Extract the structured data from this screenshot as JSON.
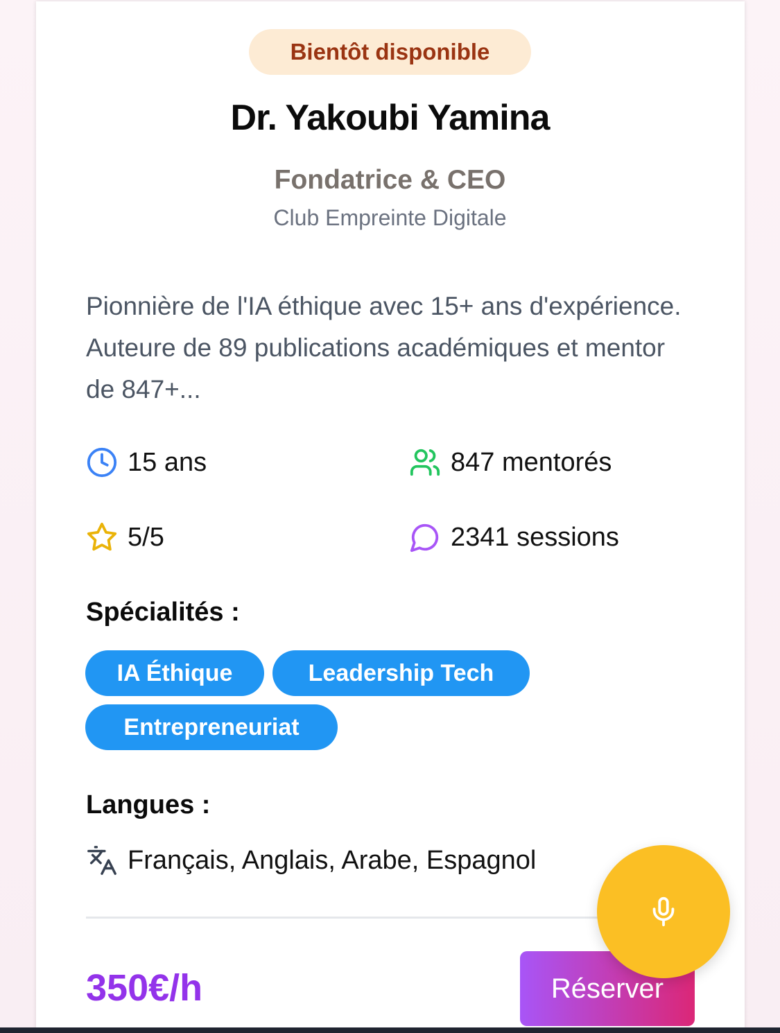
{
  "badge": "Bientôt disponible",
  "mentor": {
    "name": "Dr. Yakoubi Yamina",
    "role": "Fondatrice & CEO",
    "organization": "Club Empreinte Digitale",
    "bio": "Pionnière de l'IA éthique avec 15+ ans d'expérience. Auteure de 89 publications académiques et mentor de 847+..."
  },
  "stats": {
    "experience": "15 ans",
    "mentees": "847 mentorés",
    "rating": "5/5",
    "sessions": "2341 sessions"
  },
  "specialties": {
    "title": "Spécialités :",
    "items": [
      "IA Éthique",
      "Leadership Tech",
      "Entrepreneuriat"
    ]
  },
  "languages": {
    "title": "Langues :",
    "value": "Français, Anglais, Arabe, Espagnol"
  },
  "price": "350€/h",
  "reserve_label": "Réserver",
  "icons": {
    "experience": "clock-icon",
    "mentees": "users-icon",
    "rating": "star-icon",
    "sessions": "message-circle-icon",
    "languages": "translate-icon",
    "mic": "microphone-icon"
  },
  "colors": {
    "badge_bg": "#fdebd4",
    "badge_text": "#9a3412",
    "chip": "#2196f3",
    "price": "#9333ea",
    "mic_button": "#fbbf24",
    "clock": "#3b82f6",
    "users": "#22c55e",
    "star": "#eab308",
    "message": "#a855f7"
  }
}
